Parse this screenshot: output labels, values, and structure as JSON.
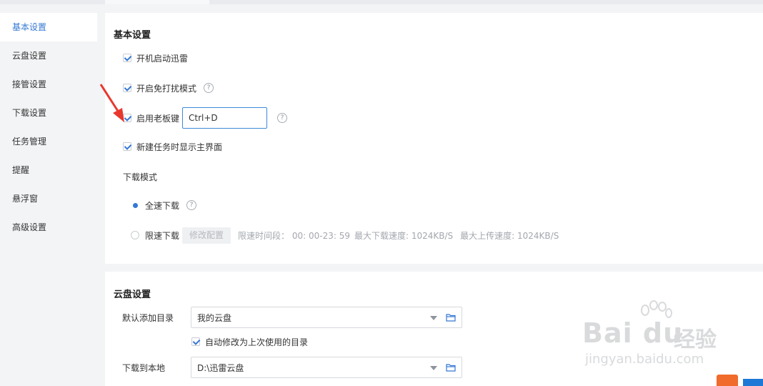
{
  "sidebar": {
    "items": [
      {
        "label": "基本设置",
        "active": true
      },
      {
        "label": "云盘设置"
      },
      {
        "label": "接管设置"
      },
      {
        "label": "下载设置"
      },
      {
        "label": "任务管理"
      },
      {
        "label": "提醒"
      },
      {
        "label": "悬浮窗"
      },
      {
        "label": "高级设置"
      }
    ]
  },
  "basic": {
    "title": "基本设置",
    "startup": {
      "label": "开机启动迅雷",
      "checked": true
    },
    "no_disturb": {
      "label": "开启免打扰模式",
      "checked": true
    },
    "boss_key": {
      "label": "启用老板键",
      "checked": true,
      "value": "Ctrl+D"
    },
    "show_main": {
      "label": "新建任务时显示主界面",
      "checked": true
    },
    "download_mode": {
      "title": "下载模式",
      "full_speed": {
        "label": "全速下载",
        "selected": true
      },
      "limited": {
        "label": "限速下载",
        "selected": false,
        "config_button": "修改配置",
        "time_range": "限速时间段： 00: 00-23: 59",
        "max_download": "最大下载速度: 1024KB/S",
        "max_upload": "最大上传速度: 1024KB/S"
      }
    }
  },
  "cloud": {
    "title": "云盘设置",
    "default_dir": {
      "label": "默认添加目录",
      "value": "我的云盘"
    },
    "auto_modify": {
      "label": "自动修改为上次使用的目录",
      "checked": true
    },
    "download_local": {
      "label": "下载到本地",
      "value": "D:\\迅雷云盘"
    }
  },
  "watermark": {
    "brand": "Bai du",
    "cn": "经验",
    "url": "jingyan.baidu.com"
  },
  "colors": {
    "accent": "#3478d4",
    "arrow": "#e8382e"
  },
  "icons": [
    "check-icon",
    "help-icon",
    "radio-dot-icon",
    "caret-down-icon",
    "folder-icon",
    "red-arrow-icon"
  ]
}
